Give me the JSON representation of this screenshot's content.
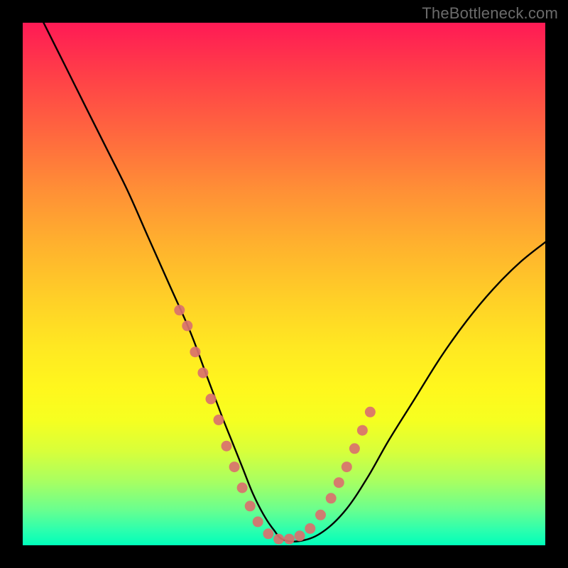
{
  "watermark": "TheBottleneck.com",
  "chart_data": {
    "type": "line",
    "title": "",
    "xlabel": "",
    "ylabel": "",
    "xlim": [
      0,
      100
    ],
    "ylim": [
      0,
      100
    ],
    "series": [
      {
        "name": "curve",
        "x": [
          4,
          8,
          12,
          16,
          20,
          24,
          28,
          32,
          35,
          38,
          40,
          42,
          44,
          46,
          48,
          50,
          54,
          58,
          62,
          66,
          70,
          75,
          80,
          85,
          90,
          95,
          100
        ],
        "y": [
          100,
          92,
          84,
          76,
          68,
          59,
          50,
          41,
          33,
          25,
          20,
          15,
          10,
          6,
          3,
          1,
          1,
          3,
          7,
          13,
          20,
          28,
          36,
          43,
          49,
          54,
          58
        ]
      }
    ],
    "markers": {
      "name": "highlight-dots",
      "color": "#d9716e",
      "points": [
        {
          "x": 30,
          "y": 45
        },
        {
          "x": 31.5,
          "y": 42
        },
        {
          "x": 33,
          "y": 37
        },
        {
          "x": 34.5,
          "y": 33
        },
        {
          "x": 36,
          "y": 28
        },
        {
          "x": 37.5,
          "y": 24
        },
        {
          "x": 39,
          "y": 19
        },
        {
          "x": 40.5,
          "y": 15
        },
        {
          "x": 42,
          "y": 11
        },
        {
          "x": 43.5,
          "y": 7.5
        },
        {
          "x": 45,
          "y": 4.5
        },
        {
          "x": 47,
          "y": 2.2
        },
        {
          "x": 49,
          "y": 1.2
        },
        {
          "x": 51,
          "y": 1.2
        },
        {
          "x": 53,
          "y": 1.8
        },
        {
          "x": 55,
          "y": 3.2
        },
        {
          "x": 57,
          "y": 5.8
        },
        {
          "x": 59,
          "y": 9
        },
        {
          "x": 60.5,
          "y": 12
        },
        {
          "x": 62,
          "y": 15
        },
        {
          "x": 63.5,
          "y": 18.5
        },
        {
          "x": 65,
          "y": 22
        },
        {
          "x": 66.5,
          "y": 25.5
        }
      ]
    },
    "gradient_bands": [
      {
        "y": 0,
        "color": "#ff1a55"
      },
      {
        "y": 30,
        "color": "#ff8f36"
      },
      {
        "y": 60,
        "color": "#ffe822"
      },
      {
        "y": 85,
        "color": "#a6ff63"
      },
      {
        "y": 100,
        "color": "#00ffba"
      }
    ]
  }
}
